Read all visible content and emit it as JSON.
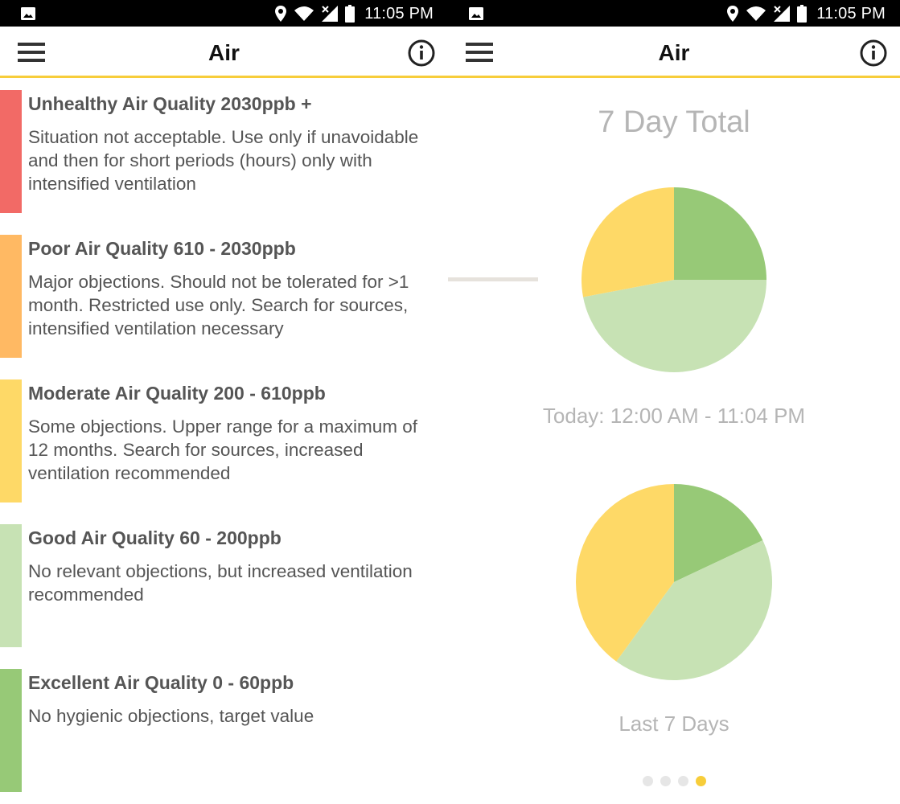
{
  "status_bar": {
    "time": "11:05 PM"
  },
  "app_bar": {
    "title": "Air"
  },
  "quality_levels": [
    {
      "heading": "Unhealthy Air Quality 2030ppb +",
      "description": "Situation not acceptable. Use only if unavoidable and then for short periods (hours) only with intensified ventilation",
      "color": "#f26a66"
    },
    {
      "heading": "Poor Air Quality 610 - 2030ppb",
      "description": "Major objections. Should not be tolerated for >1 month. Restricted use only. Search for sources, intensified ventilation necessary",
      "color": "#ffb963"
    },
    {
      "heading": "Moderate Air Quality 200 - 610ppb",
      "description": "Some objections. Upper range for a maximum of 12 months. Search for sources, increased ventilation recommended",
      "color": "#fed967"
    },
    {
      "heading": "Good Air Quality 60 - 200ppb",
      "description": "No relevant objections, but increased ventilation recommended",
      "color": "#c7e2b4"
    },
    {
      "heading": "Excellent Air Quality 0 - 60ppb",
      "description": "No hygienic objections, target value",
      "color": "#97c977"
    }
  ],
  "summary": {
    "title": "7 Day Total",
    "pager": {
      "total": 4,
      "active": 3
    }
  },
  "chart_data": [
    {
      "type": "pie",
      "caption": "Today: 12:00 AM - 11:04 PM",
      "slices": [
        {
          "label": "Excellent",
          "value": 25,
          "color": "#97c977"
        },
        {
          "label": "Good",
          "value": 47,
          "color": "#c7e2b4"
        },
        {
          "label": "Moderate",
          "value": 28,
          "color": "#fed967"
        }
      ]
    },
    {
      "type": "pie",
      "caption": "Last 7 Days",
      "slices": [
        {
          "label": "Excellent",
          "value": 18,
          "color": "#97c977"
        },
        {
          "label": "Good",
          "value": 42,
          "color": "#c7e2b4"
        },
        {
          "label": "Moderate",
          "value": 40,
          "color": "#fed967"
        }
      ]
    }
  ]
}
